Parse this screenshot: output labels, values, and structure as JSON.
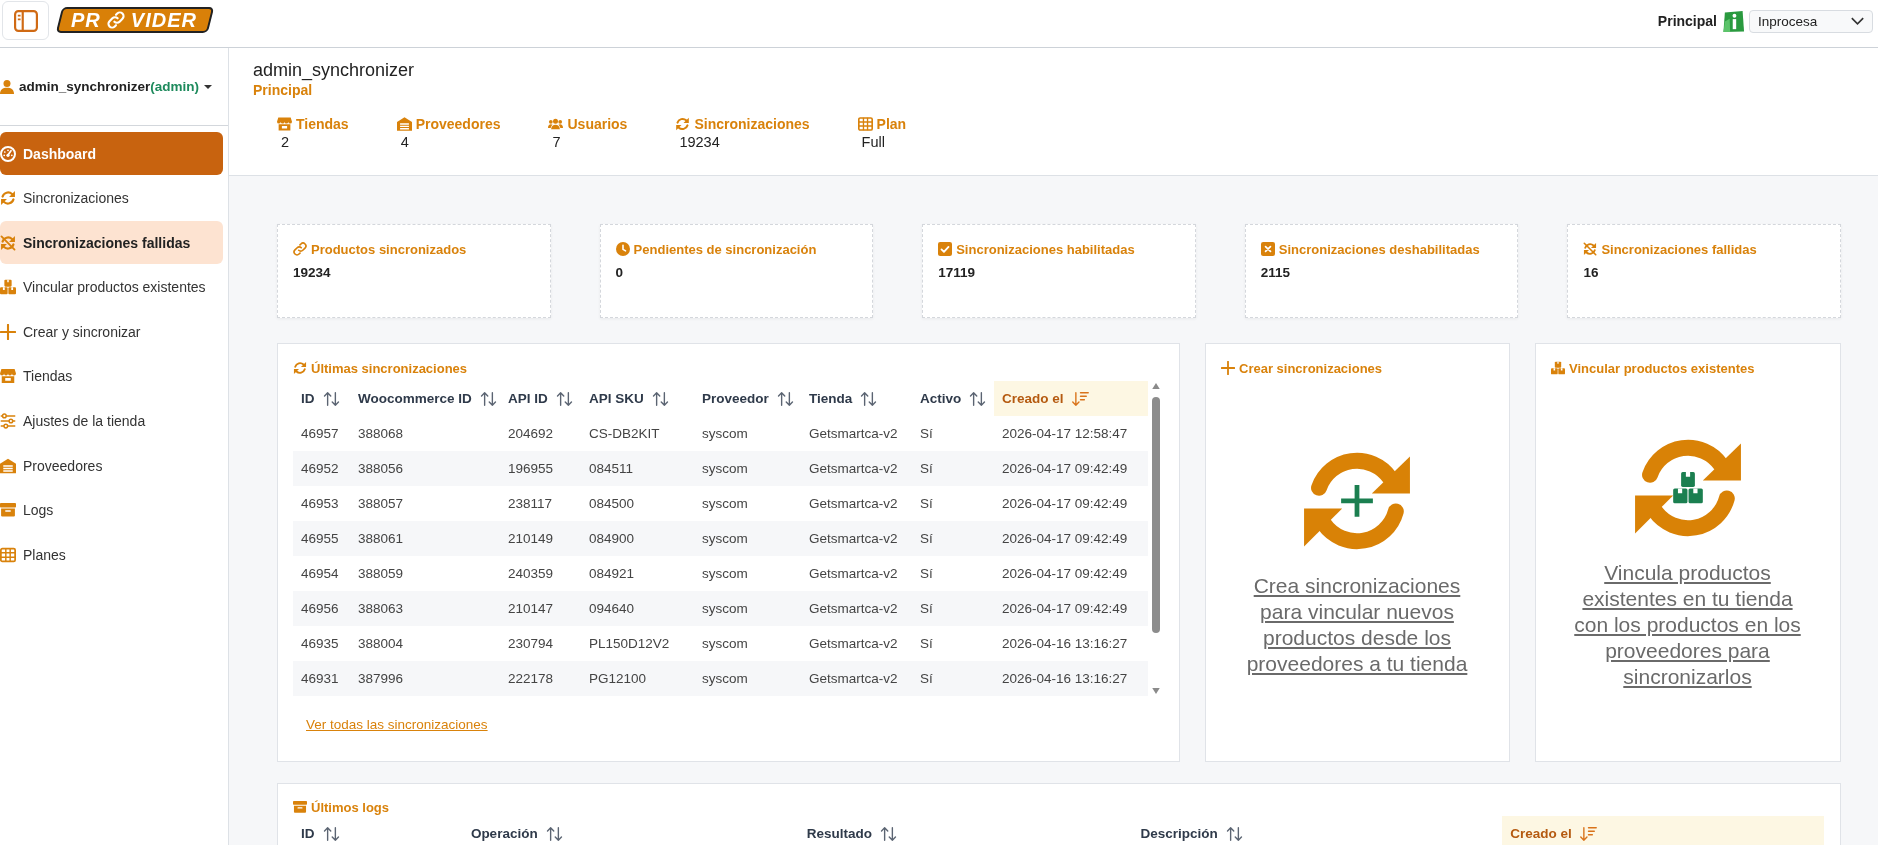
{
  "top_bar": {
    "logo": {
      "text_start": "PR",
      "text_end": "VIDER"
    },
    "context_label": "Principal",
    "store_select": {
      "value": "Inprocesa"
    }
  },
  "sidebar": {
    "user": {
      "name": "admin_synchronizer",
      "role": "(admin)"
    },
    "items": [
      {
        "label": "Dashboard",
        "selected": true,
        "hovered": false
      },
      {
        "label": "Sincronizaciones",
        "selected": false,
        "hovered": false
      },
      {
        "label": "Sincronizaciones fallidas",
        "selected": false,
        "hovered": true
      },
      {
        "label": "Vincular productos existentes",
        "selected": false,
        "hovered": false
      },
      {
        "label": "Crear y sincronizar",
        "selected": false,
        "hovered": false
      },
      {
        "label": "Tiendas",
        "selected": false,
        "hovered": false
      },
      {
        "label": "Ajustes de la tienda",
        "selected": false,
        "hovered": false
      },
      {
        "label": "Proveedores",
        "selected": false,
        "hovered": false
      },
      {
        "label": "Logs",
        "selected": false,
        "hovered": false
      },
      {
        "label": "Planes",
        "selected": false,
        "hovered": false
      }
    ]
  },
  "header": {
    "title": "admin_synchronizer",
    "subtitle": "Principal",
    "stats": [
      {
        "label": "Tiendas",
        "value": "2"
      },
      {
        "label": "Proveedores",
        "value": "4"
      },
      {
        "label": "Usuarios",
        "value": "7"
      },
      {
        "label": "Sincronizaciones",
        "value": "19234"
      },
      {
        "label": "Plan",
        "value": "Full"
      }
    ]
  },
  "stat_cards": [
    {
      "label": "Productos sincronizados",
      "value": "19234"
    },
    {
      "label": "Pendientes de sincronización",
      "value": "0"
    },
    {
      "label": "Sincronizaciones habilitadas",
      "value": "17119"
    },
    {
      "label": "Sincronizaciones deshabilitadas",
      "value": "2115"
    },
    {
      "label": "Sincronizaciones fallidas",
      "value": "16"
    }
  ],
  "sync_table": {
    "title": "Últimas sincronizaciones",
    "columns": [
      {
        "label": "ID",
        "sorted": false
      },
      {
        "label": "Woocommerce ID",
        "sorted": false
      },
      {
        "label": "API ID",
        "sorted": false
      },
      {
        "label": "API SKU",
        "sorted": false
      },
      {
        "label": "Proveedor",
        "sorted": false
      },
      {
        "label": "Tienda",
        "sorted": false
      },
      {
        "label": "Activo",
        "sorted": false
      },
      {
        "label": "Creado el",
        "sorted": true
      }
    ],
    "rows": [
      [
        "46957",
        "388068",
        "204692",
        "CS-DB2KIT",
        "syscom",
        "Getsmartca-v2",
        "Sí",
        "2026-04-17 12:58:47"
      ],
      [
        "46952",
        "388056",
        "196955",
        "084511",
        "syscom",
        "Getsmartca-v2",
        "Sí",
        "2026-04-17 09:42:49"
      ],
      [
        "46953",
        "388057",
        "238117",
        "084500",
        "syscom",
        "Getsmartca-v2",
        "Sí",
        "2026-04-17 09:42:49"
      ],
      [
        "46955",
        "388061",
        "210149",
        "084900",
        "syscom",
        "Getsmartca-v2",
        "Sí",
        "2026-04-17 09:42:49"
      ],
      [
        "46954",
        "388059",
        "240359",
        "084921",
        "syscom",
        "Getsmartca-v2",
        "Sí",
        "2026-04-17 09:42:49"
      ],
      [
        "46956",
        "388063",
        "210147",
        "094640",
        "syscom",
        "Getsmartca-v2",
        "Sí",
        "2026-04-17 09:42:49"
      ],
      [
        "46935",
        "388004",
        "230794",
        "PL150D12V2",
        "syscom",
        "Getsmartca-v2",
        "Sí",
        "2026-04-16 13:16:27"
      ],
      [
        "46931",
        "387996",
        "222178",
        "PG12100",
        "syscom",
        "Getsmartca-v2",
        "Sí",
        "2026-04-16 13:16:27"
      ]
    ],
    "link": "Ver todas las sincronizaciones"
  },
  "action_cards": [
    {
      "title": "Crear sincronizaciones",
      "text": "Crea sincronizaciones para vincular nuevos productos desde los proveedores a tu tienda"
    },
    {
      "title": "Vincular productos existentes",
      "text": "Vincula productos existentes en tu tienda con los productos en los proveedores para sincronizarlos"
    }
  ],
  "logs": {
    "title": "Últimos logs",
    "columns": [
      {
        "label": "ID",
        "sorted": false
      },
      {
        "label": "Operación",
        "sorted": false
      },
      {
        "label": "Resultado",
        "sorted": false
      },
      {
        "label": "Descripción",
        "sorted": false
      },
      {
        "label": "Creado el",
        "sorted": true
      }
    ]
  }
}
